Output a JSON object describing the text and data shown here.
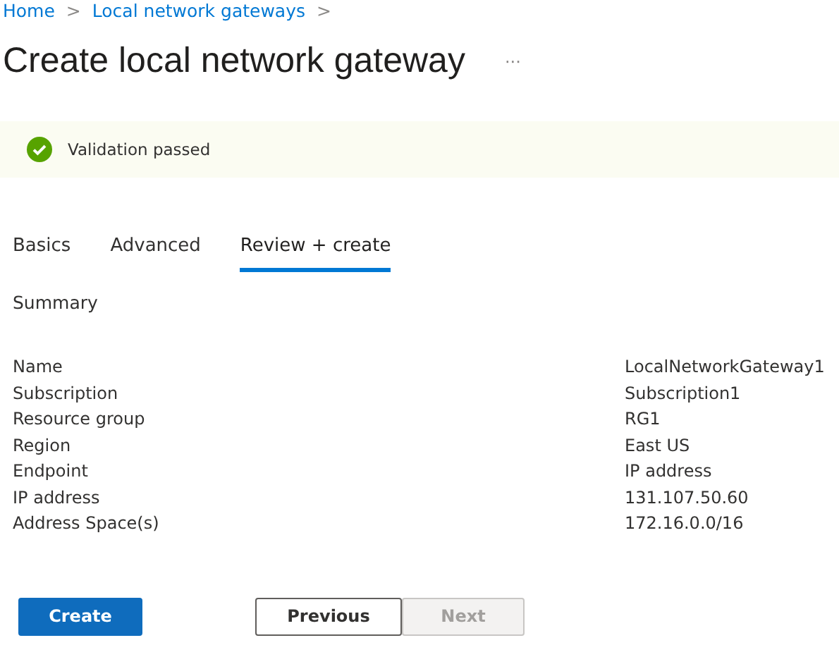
{
  "breadcrumb": [
    {
      "label": "Home",
      "separator": ">"
    },
    {
      "label": "Local network gateways",
      "separator": ">"
    }
  ],
  "title": "Create local network gateway",
  "more": "···",
  "banner": {
    "passed": true,
    "text": "Validation passed"
  },
  "tabs": [
    {
      "label": "Basics",
      "selected": false
    },
    {
      "label": "Advanced",
      "selected": false
    },
    {
      "label": "Review + create",
      "selected": true
    }
  ],
  "section": "Summary",
  "summary": [
    {
      "label": "Name",
      "value": "LocalNetworkGateway1"
    },
    {
      "label": "Subscription",
      "value": "Subscription1"
    },
    {
      "label": "Resource group",
      "value": "RG1"
    },
    {
      "label": "Region",
      "value": "East US"
    },
    {
      "label": "Endpoint",
      "value": "IP address"
    },
    {
      "label": "IP address",
      "value": "131.107.50.60"
    },
    {
      "label": "Address Space(s)",
      "value": "172.16.0.0/16"
    }
  ],
  "buttons": [
    {
      "label": "Create",
      "kind": "primary",
      "disabled": false
    },
    {
      "label": "Previous",
      "kind": "secondary",
      "disabled": false
    },
    {
      "label": "Next",
      "kind": "secondary",
      "disabled": true
    }
  ]
}
